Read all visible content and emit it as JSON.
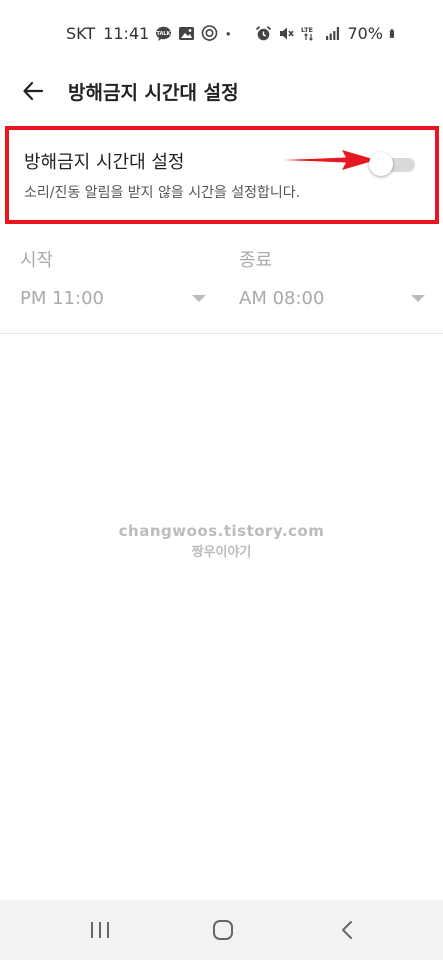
{
  "status_bar": {
    "carrier": "SKT",
    "time": "11:41",
    "battery": "70%",
    "network": "LTE",
    "icons_left": [
      "talk-icon",
      "image-icon",
      "location-icon",
      "dot-icon"
    ],
    "icons_right": [
      "alarm-icon",
      "mute-icon",
      "lte-icon",
      "signal-icon",
      "battery-icon"
    ]
  },
  "app_bar": {
    "title": "방해금지 시간대 설정",
    "back_icon": "arrow-left-icon"
  },
  "dnd": {
    "title": "방해금지 시간대 설정",
    "description": "소리/진동 알림을 받지 않을 시간을 설정합니다.",
    "enabled": false
  },
  "time": {
    "start_label": "시작",
    "start_value": "PM 11:00",
    "end_label": "종료",
    "end_value": "AM 08:00"
  },
  "watermark": {
    "line1": "changwoos.tistory.com",
    "line2": "짱우이야기"
  },
  "colors": {
    "highlight_border": "#e8161e",
    "arrow": "#e8161e",
    "muted_text": "#aaaaaa",
    "nav_bg": "#f2f2f2"
  },
  "nav_bar": {
    "icons": [
      "recent-apps-icon",
      "home-icon",
      "back-icon"
    ]
  }
}
